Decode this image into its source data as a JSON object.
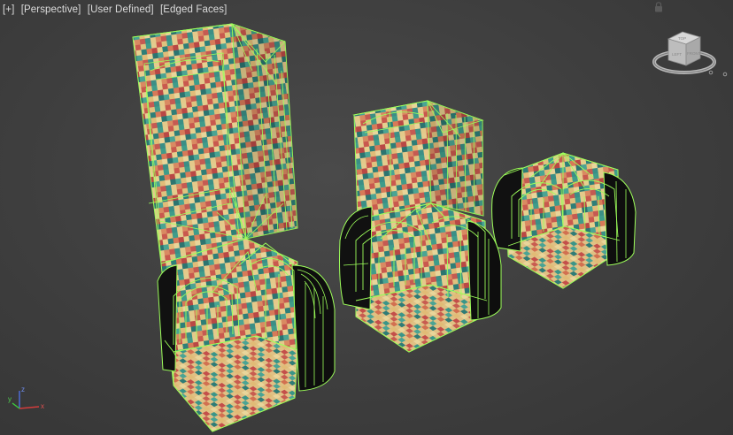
{
  "viewport": {
    "label_plus": "[+]",
    "label_view": "[Perspective]",
    "label_shading_type": "[User Defined]",
    "label_shading": "[Edged Faces]"
  },
  "viewcube": {
    "face_front": "FRONT",
    "face_top": "TOP",
    "face_left": "LEFT"
  },
  "axis": {
    "x": "x",
    "y": "y",
    "z": "z"
  },
  "colors": {
    "wire": "#9dff5a",
    "background": "#3c3c3c",
    "axis_x": "#d23c3c",
    "axis_y": "#3ccc3c",
    "axis_z": "#4f6fe0"
  },
  "icons": [
    "lock-icon",
    "viewcube-icon",
    "home-icon"
  ]
}
